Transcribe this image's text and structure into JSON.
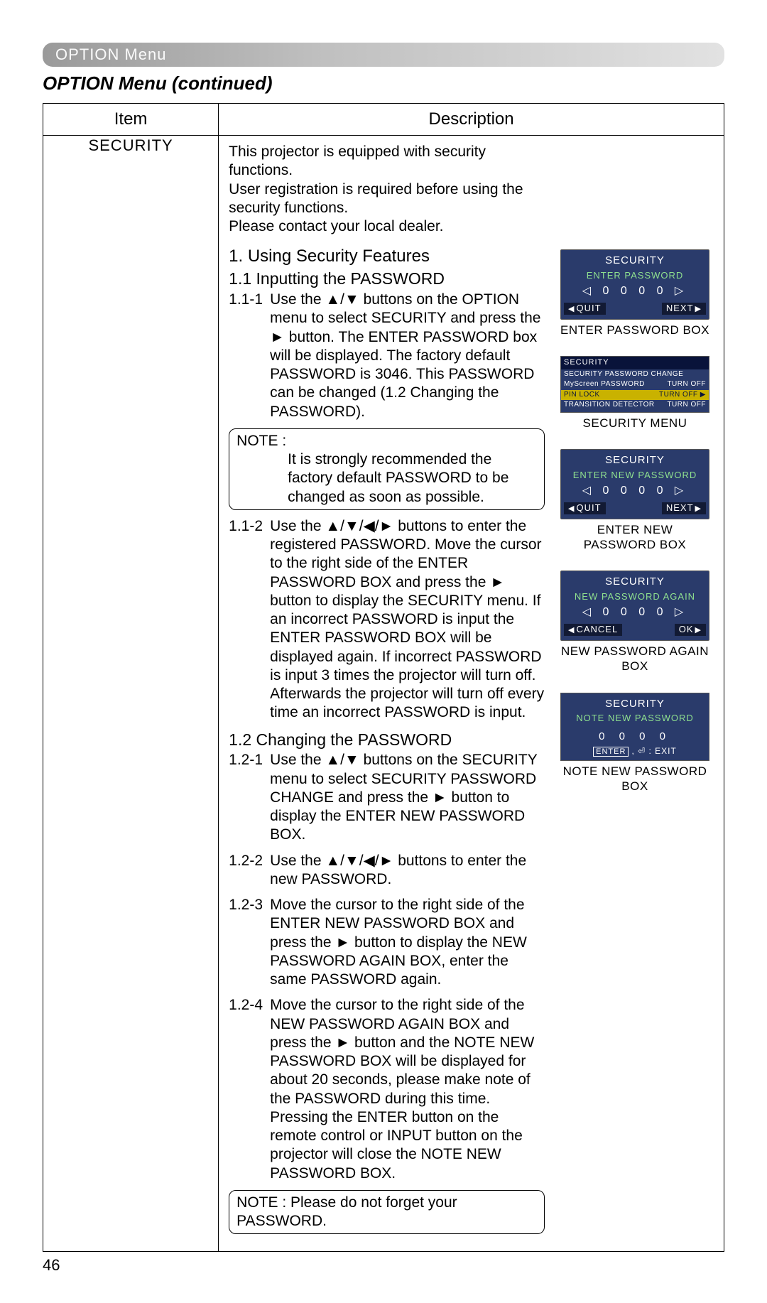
{
  "breadcrumb": "OPTION Menu",
  "title": "OPTION Menu (continued)",
  "table": {
    "headers": {
      "item": "Item",
      "desc": "Description"
    },
    "item_label": "SECURITY"
  },
  "intro": "This projector is equipped with security functions.\nUser registration is required before using the security functions.\nPlease contact your local dealer.",
  "sec1_h": "1. Using Security Features",
  "sec11_h": "1.1 Inputting the PASSWORD",
  "step111_no": "1.1-1 ",
  "step111": "Use the ▲/▼ buttons on the OPTION menu to select SECURITY and press the ► button. The ENTER PASSWORD box will be displayed. The factory default PASSWORD is 3046. This PASSWORD can be changed (1.2 Changing the PASSWORD).",
  "note1_label": "NOTE : ",
  "note1": "It is strongly recommended the factory default PASSWORD to be changed as soon as possible.",
  "step112_no": "1.1-2 ",
  "step112": "Use the ▲/▼/◀/► buttons to enter the registered PASSWORD. Move the cursor to the right side of the ENTER PASSWORD BOX and press the ► button to display the SECURITY menu. If an incorrect PASSWORD is input the ENTER PASSWORD BOX will be displayed again. If incorrect PASSWORD is input 3 times the projector will turn off. Afterwards the projector will turn off every time an incorrect PASSWORD is input.",
  "sec12_h": "1.2 Changing the PASSWORD",
  "step121_no": "1.2-1 ",
  "step121": "Use the ▲/▼ buttons on the SECURITY menu to select SECURITY PASSWORD CHANGE and press the ► button to display the ENTER NEW PASSWORD BOX.",
  "step122_no": "1.2-2 ",
  "step122": "Use the ▲/▼/◀/► buttons to enter the new PASSWORD.",
  "step123_no": "1.2-3 ",
  "step123": "Move the cursor to the right side of the ENTER NEW PASSWORD BOX and press the ► button to display the NEW PASSWORD AGAIN BOX, enter the same PASSWORD again.",
  "step124_no": "1.2-4 ",
  "step124": "Move the cursor to the right side of the NEW PASSWORD AGAIN BOX and press the ► button and the NOTE NEW PASSWORD BOX will be displayed for about 20 seconds, please make note of the PASSWORD during this time. Pressing the ENTER button on the remote control or INPUT button on the projector will close the NOTE NEW PASSWORD BOX.",
  "note2": "NOTE : Please do not forget your PASSWORD.",
  "page_num": "46",
  "osd": {
    "enter_pw": {
      "title": "SECURITY",
      "sub": "ENTER PASSWORD",
      "digits": "0  0  0  0",
      "left": "QUIT",
      "right": "NEXT",
      "caption": "ENTER PASSWORD BOX"
    },
    "sec_menu": {
      "title": "SECURITY",
      "rows": [
        {
          "l": "SECURITY PASSWORD CHANGE",
          "r": ""
        },
        {
          "l": "MyScreen PASSWORD",
          "r": "TURN OFF"
        },
        {
          "l": "PIN LOCK",
          "r": "TURN OFF ▶",
          "sel": true
        },
        {
          "l": "TRANSITION DETECTOR",
          "r": "TURN OFF"
        }
      ],
      "caption": "SECURITY MENU"
    },
    "new_pw": {
      "title": "SECURITY",
      "sub": "ENTER NEW PASSWORD",
      "digits": "0  0  0  0",
      "left": "QUIT",
      "right": "NEXT",
      "caption": "ENTER NEW PASSWORD BOX"
    },
    "again_pw": {
      "title": "SECURITY",
      "sub": "NEW PASSWORD AGAIN",
      "digits": "0  0  0  0",
      "left": "CANCEL",
      "right": "OK",
      "caption": "NEW PASSWORD AGAIN BOX"
    },
    "note_pw": {
      "title": "SECURITY",
      "sub": "NOTE NEW PASSWORD",
      "digits": "0  0  0  0",
      "exit": "ENTER , ⏎ : EXIT",
      "caption": "NOTE NEW PASSWORD BOX"
    }
  }
}
